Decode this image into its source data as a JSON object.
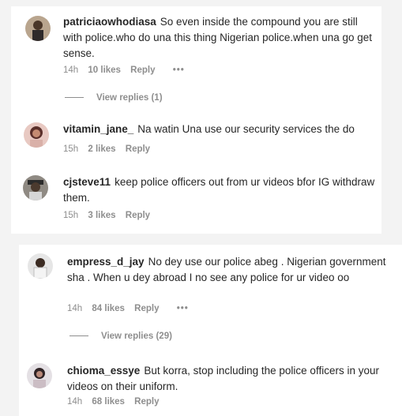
{
  "card1": {
    "comments": [
      {
        "username": "patriciaowhodiasa",
        "text": "So even inside the compound you are still with police.who do una this thing Nigerian police.when una go get sense.",
        "time": "14h",
        "likes": "10 likes",
        "reply": "Reply",
        "more": "•••",
        "view_replies": "View replies (1)"
      },
      {
        "username": "vitamin_jane_",
        "text": "Na watin Una use our security services the do",
        "time": "15h",
        "likes": "2 likes",
        "reply": "Reply"
      },
      {
        "username": "cjsteve11",
        "text": "keep police officers out from ur videos bfor IG withdraw them.",
        "time": "15h",
        "likes": "3 likes",
        "reply": "Reply"
      }
    ]
  },
  "card2": {
    "comments": [
      {
        "username": "empress_d_jay",
        "text": "No dey use our police abeg . Nigerian government sha . When u dey abroad I no see any police for ur video oo",
        "time": "14h",
        "likes": "84 likes",
        "reply": "Reply",
        "more": "•••",
        "view_replies": "View replies (29)"
      },
      {
        "username": "chioma_essye",
        "text": "But korra, stop including the police officers in your videos on their uniform.",
        "time": "14h",
        "likes": "68 likes",
        "reply": "Reply"
      }
    ]
  }
}
